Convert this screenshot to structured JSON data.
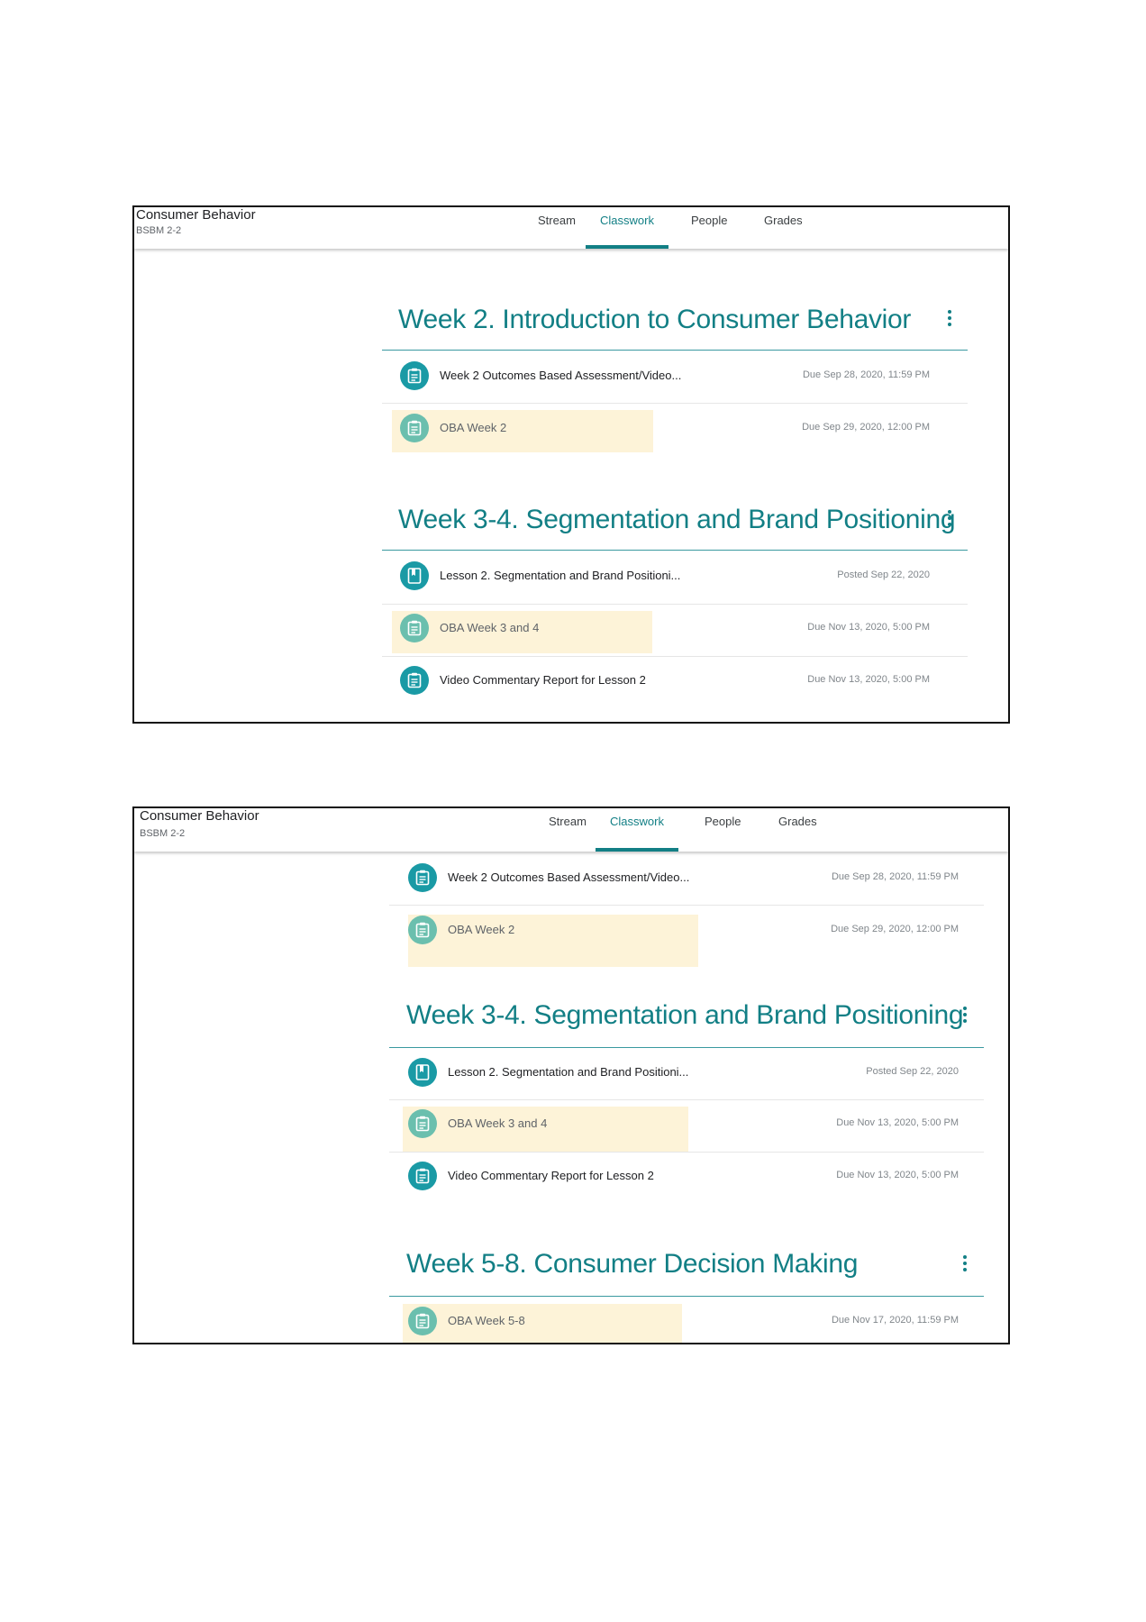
{
  "course": {
    "title": "Consumer Behavior",
    "section": "BSBM 2-2"
  },
  "tabs": [
    {
      "label": "Stream",
      "active": false
    },
    {
      "label": "Classwork",
      "active": true
    },
    {
      "label": "People",
      "active": false
    },
    {
      "label": "Grades",
      "active": false
    }
  ],
  "colors": {
    "accent": "#127f85",
    "icon_active": "#1a9aa5",
    "icon_dim": "#6bbfae",
    "highlight": "#fdf3d8"
  },
  "screenshot_1": {
    "topics": [
      {
        "title": "Week 2. Introduction to Consumer Behavior",
        "items": [
          {
            "icon": "assignment-icon",
            "title": "Week 2 Outcomes Based Assessment/Video...",
            "meta": "Due Sep 28, 2020, 11:59 PM"
          },
          {
            "icon": "assignment-icon",
            "title": "OBA Week 2",
            "meta": "Due Sep 29, 2020, 12:00 PM"
          }
        ]
      },
      {
        "title": "Week 3-4. Segmentation and Brand Positioning",
        "items": [
          {
            "icon": "material-icon",
            "title": "Lesson 2. Segmentation and Brand Positioni...",
            "meta": "Posted Sep 22, 2020"
          },
          {
            "icon": "assignment-icon",
            "title": "OBA Week 3 and 4",
            "meta": "Due Nov 13, 2020, 5:00 PM"
          },
          {
            "icon": "assignment-icon",
            "title": "Video Commentary Report for Lesson 2",
            "meta": "Due Nov 13, 2020, 5:00 PM"
          }
        ]
      }
    ]
  },
  "screenshot_2": {
    "items_top": [
      {
        "icon": "assignment-icon",
        "title": "Week 2 Outcomes Based Assessment/Video...",
        "meta": "Due Sep 28, 2020, 11:59 PM"
      },
      {
        "icon": "assignment-icon",
        "title": "OBA Week 2",
        "meta": "Due Sep 29, 2020, 12:00 PM"
      }
    ],
    "topics": [
      {
        "title": "Week 3-4. Segmentation and Brand Positioning",
        "items": [
          {
            "icon": "material-icon",
            "title": "Lesson 2. Segmentation and Brand Positioni...",
            "meta": "Posted Sep 22, 2020"
          },
          {
            "icon": "assignment-icon",
            "title": "OBA Week 3 and 4",
            "meta": "Due Nov 13, 2020, 5:00 PM"
          },
          {
            "icon": "assignment-icon",
            "title": "Video Commentary Report for Lesson 2",
            "meta": "Due Nov 13, 2020, 5:00 PM"
          }
        ]
      },
      {
        "title": "Week 5-8. Consumer Decision Making",
        "items": [
          {
            "icon": "assignment-icon",
            "title": "OBA Week 5-8",
            "meta": "Due Nov 17, 2020, 11:59 PM"
          }
        ]
      }
    ]
  }
}
